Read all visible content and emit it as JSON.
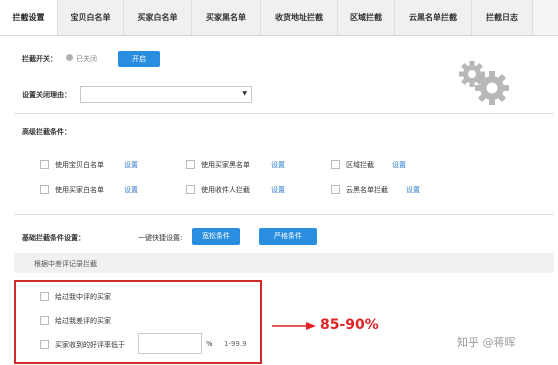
{
  "tabs": [
    {
      "label": "拦截设置",
      "active": true
    },
    {
      "label": "宝贝白名单"
    },
    {
      "label": "买家白名单"
    },
    {
      "label": "买家黑名单"
    },
    {
      "label": "收货地址拦截"
    },
    {
      "label": "区域拦截"
    },
    {
      "label": "云黑名单拦截"
    },
    {
      "label": "拦截日志"
    }
  ],
  "switch": {
    "label": "拦截开关：",
    "status": "已关闭",
    "open_button": "开启"
  },
  "reason": {
    "label": "设置关闭理由：",
    "value": ""
  },
  "advanced": {
    "title": "高级拦截条件：",
    "items": [
      {
        "label": "使用宝贝白名单",
        "link": "设置"
      },
      {
        "label": "使用买家黑名单",
        "link": "设置"
      },
      {
        "label": "区域拦截",
        "link": "设置"
      },
      {
        "label": "使用买家白名单",
        "link": "设置"
      },
      {
        "label": "使用收件人拦截",
        "link": "设置"
      },
      {
        "label": "云黑名单拦截",
        "link": "设置"
      }
    ]
  },
  "basic": {
    "title": "基础拦截条件设置：",
    "quick_label": "一键快捷设置:",
    "loose_button": "宽松条件",
    "strict_button": "严格条件",
    "section_header": "根据中差评记录拦截",
    "options": [
      {
        "label": "给过我中评的买家"
      },
      {
        "label": "给过我差评的买家"
      },
      {
        "label": "买家收到的好评率低于",
        "value": "",
        "unit": "%",
        "range": "1-99.9"
      }
    ]
  },
  "annotation": {
    "text": "85-90%",
    "color": "#e02424"
  },
  "watermark": "知乎 @蒋晖",
  "colors": {
    "accent": "#2a8ee0",
    "link": "#2f7cc9",
    "highlight": "#d12a2a"
  }
}
